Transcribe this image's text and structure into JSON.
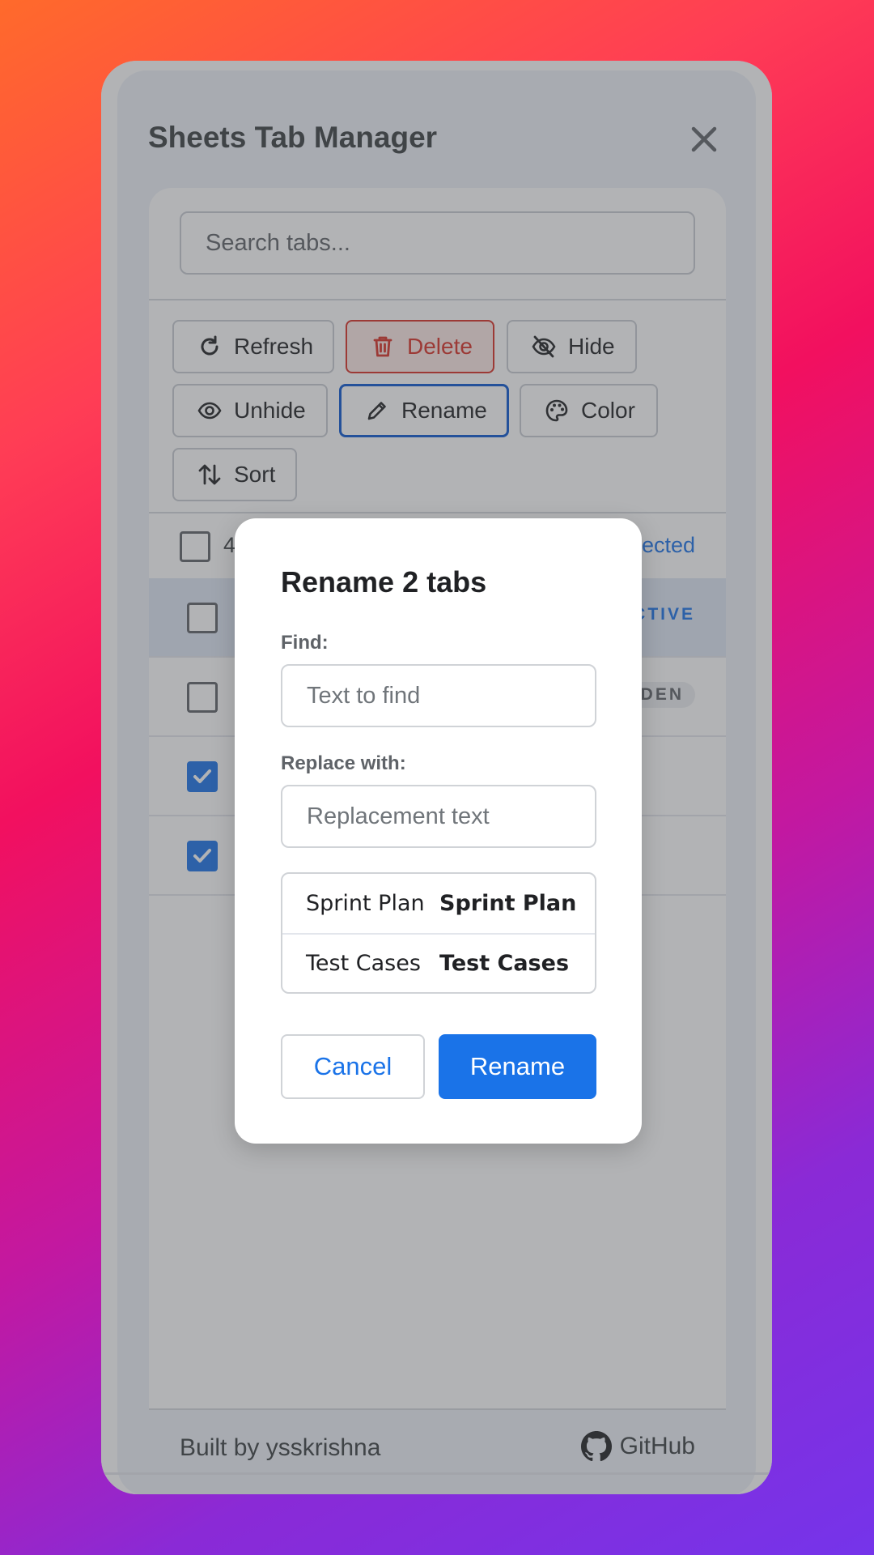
{
  "dialog": {
    "title": "Sheets Tab Manager",
    "search_placeholder": "Search tabs...",
    "toolbar": {
      "refresh_label": "Refresh",
      "delete_label": "Delete",
      "hide_label": "Hide",
      "unhide_label": "Unhide",
      "rename_label": "Rename",
      "color_label": "Color",
      "sort_label": "Sort"
    },
    "list": {
      "header_count": "4",
      "selected_text": "ected",
      "rows": [
        {
          "checked": false,
          "badge": "CTIVE"
        },
        {
          "checked": false,
          "badge": "DEN"
        },
        {
          "checked": true,
          "badge": ""
        },
        {
          "checked": true,
          "badge": ""
        }
      ]
    },
    "footer": {
      "built_by": "Built by ysskrishna",
      "github_label": "GitHub"
    }
  },
  "rename_modal": {
    "title": "Rename 2 tabs",
    "find_label": "Find:",
    "find_placeholder": "Text to find",
    "replace_label": "Replace with:",
    "replace_placeholder": "Replacement text",
    "preview": [
      {
        "old": "Sprint Plan",
        "new": "Sprint Plan"
      },
      {
        "old": "Test Cases",
        "new": "Test Cases"
      }
    ],
    "cancel_label": "Cancel",
    "confirm_label": "Rename"
  },
  "colors": {
    "accent": "#1a73e8",
    "danger": "#d93025",
    "focus_border": "#0b57d0"
  }
}
